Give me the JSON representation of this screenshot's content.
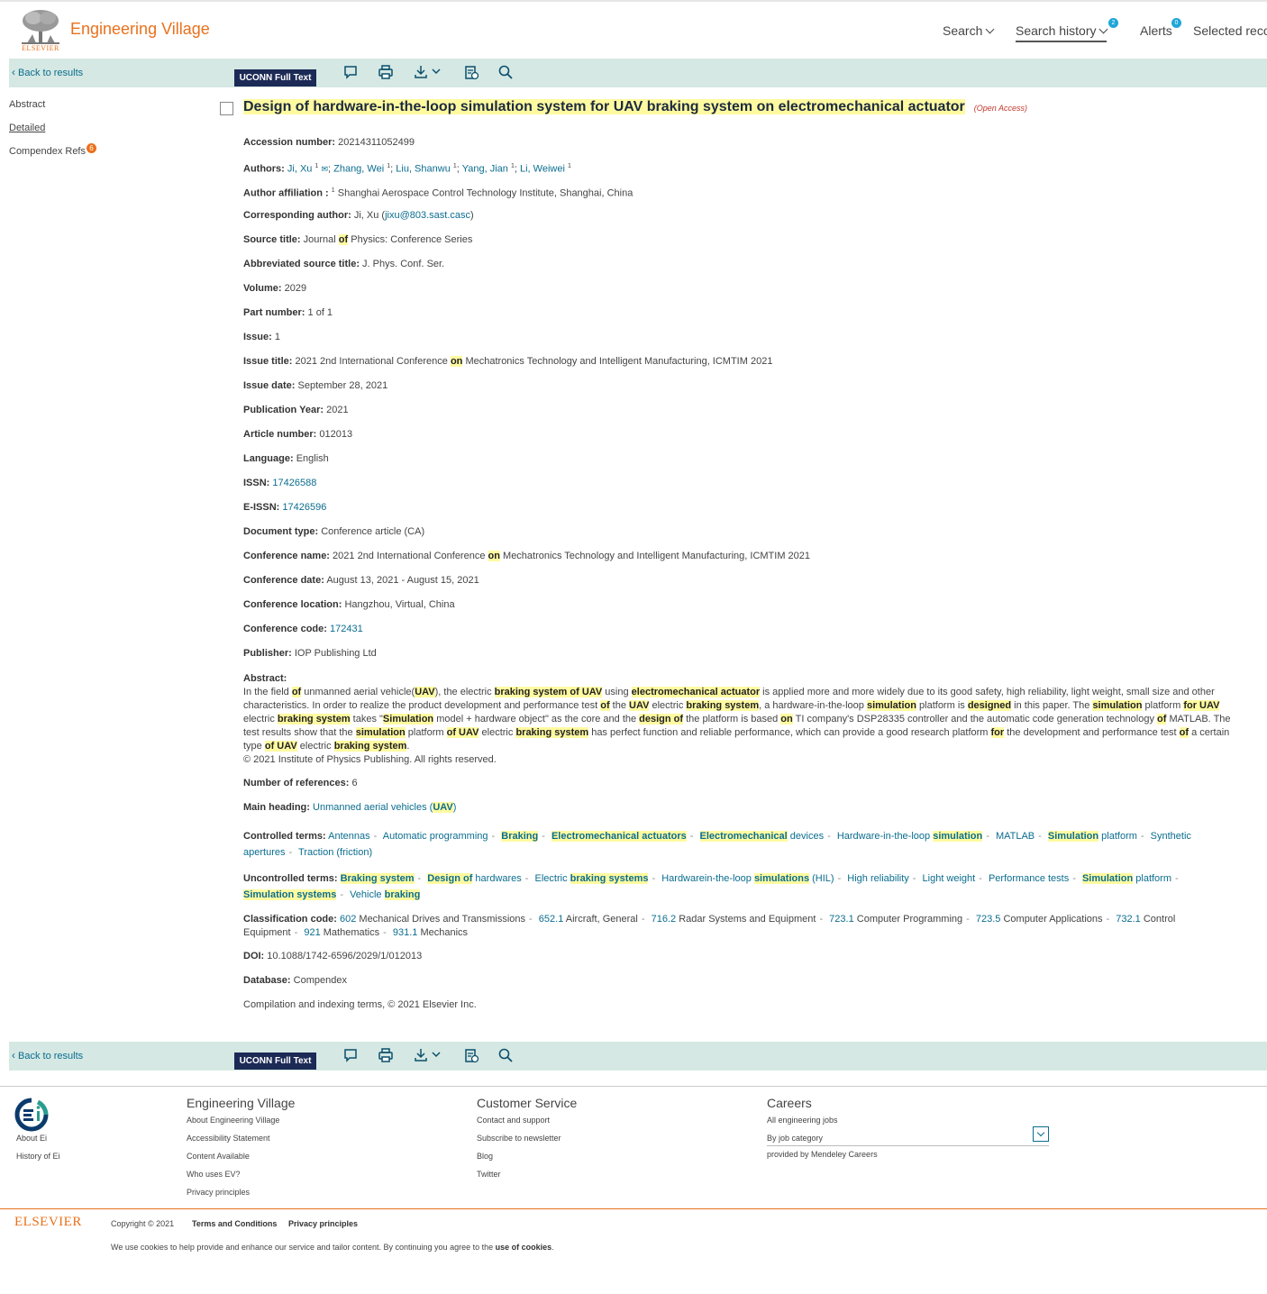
{
  "header": {
    "brand": "Engineering Village",
    "logo_word": "ELSEVIER",
    "nav": {
      "search": "Search",
      "history": "Search history",
      "history_count": "2",
      "alerts": "Alerts",
      "alerts_count": "0",
      "selected": "Selected reco"
    }
  },
  "toolbar": {
    "back": "Back to results",
    "fulltext": "UCONN Full Text"
  },
  "leftnav": {
    "abstract": "Abstract",
    "detailed": "Detailed",
    "refs": "Compendex Refs",
    "refs_count": "6"
  },
  "record": {
    "title": "Design of hardware-in-the-loop simulation system for UAV braking system on electromechanical actuator",
    "open_access": "(Open Access)",
    "accession": {
      "label": "Accession number:",
      "value": "20214311052499"
    },
    "authors_label": "Authors:",
    "authors": [
      "Ji, Xu",
      "Zhang, Wei",
      "Liu, Shanwu",
      "Yang, Jian",
      "Li, Weiwei"
    ],
    "affiliation": {
      "label": "Author affiliation :",
      "sup": "1",
      "value": "Shanghai Aerospace Control Technology Institute, Shanghai, China"
    },
    "corresponding": {
      "label": "Corresponding author:",
      "name": "Ji, Xu (",
      "email": "jixu@803.sast.casc",
      "close": ")"
    },
    "source": {
      "label": "Source title:",
      "pre": "Journal",
      "hl": "of",
      "post": "Physics: Conference Series"
    },
    "abbrev": {
      "label": "Abbreviated source title:",
      "value": "J. Phys. Conf. Ser."
    },
    "volume": {
      "label": "Volume:",
      "value": "2029"
    },
    "part": {
      "label": "Part number:",
      "value": "1 of 1"
    },
    "issue": {
      "label": "Issue:",
      "value": "1"
    },
    "issue_title": {
      "label": "Issue title:",
      "pre": "2021 2nd International Conference",
      "hl": "on",
      "post": "Mechatronics Technology and Intelligent Manufacturing, ICMTIM 2021"
    },
    "issue_date": {
      "label": "Issue date:",
      "value": "September 28, 2021"
    },
    "pub_year": {
      "label": "Publication Year:",
      "value": "2021"
    },
    "article_no": {
      "label": "Article number:",
      "value": "012013"
    },
    "language": {
      "label": "Language:",
      "value": "English"
    },
    "issn": {
      "label": "ISSN:",
      "value": "17426588"
    },
    "eissn": {
      "label": "E-ISSN:",
      "value": "17426596"
    },
    "doctype": {
      "label": "Document type:",
      "value": "Conference article (CA)"
    },
    "conf_name": {
      "label": "Conference name:",
      "pre": "2021 2nd International Conference",
      "hl": "on",
      "post": "Mechatronics Technology and Intelligent Manufacturing, ICMTIM 2021"
    },
    "conf_date": {
      "label": "Conference date:",
      "value": "August 13, 2021 - August 15, 2021"
    },
    "conf_loc": {
      "label": "Conference location:",
      "value": "Hangzhou, Virtual, China"
    },
    "conf_code": {
      "label": "Conference code:",
      "value": "172431"
    },
    "publisher": {
      "label": "Publisher:",
      "value": "IOP Publishing Ltd"
    },
    "abstract_label": "Abstract:",
    "abstract_copyright": "© 2021 Institute of Physics Publishing. All rights reserved.",
    "num_refs": {
      "label": "Number of references:",
      "value": "6"
    },
    "main_heading": {
      "label": "Main heading:",
      "value": "Unmanned aerial vehicles",
      "hl": "UAV"
    },
    "controlled_label": "Controlled terms:",
    "uncontrolled_label": "Uncontrolled terms:",
    "classification_label": "Classification code:",
    "classification": [
      {
        "code": "602",
        "desc": "Mechanical Drives and Transmissions"
      },
      {
        "code": "652.1",
        "desc": "Aircraft, General"
      },
      {
        "code": "716.2",
        "desc": "Radar Systems and Equipment"
      },
      {
        "code": "723.1",
        "desc": "Computer Programming"
      },
      {
        "code": "723.5",
        "desc": "Computer Applications"
      },
      {
        "code": "732.1",
        "desc": "Control Equipment"
      },
      {
        "code": "921",
        "desc": "Mathematics"
      },
      {
        "code": "931.1",
        "desc": "Mechanics"
      }
    ],
    "doi": {
      "label": "DOI:",
      "value": "10.1088/1742-6596/2029/1/012013"
    },
    "database": {
      "label": "Database:",
      "value": "Compendex"
    },
    "compilation": "Compilation and indexing terms, © 2021 Elsevier Inc."
  },
  "footer": {
    "ei_links": [
      "About Ei",
      "History of Ei"
    ],
    "ev_title": "Engineering Village",
    "ev_links": [
      "About Engineering Village",
      "Accessibility Statement",
      "Content Available",
      "Who uses EV?",
      "Privacy principles"
    ],
    "cs_title": "Customer Service",
    "cs_links": [
      "Contact and support",
      "Subscribe to newsletter",
      "Blog",
      "Twitter"
    ],
    "careers_title": "Careers",
    "careers_all": "All engineering jobs",
    "careers_cat": "By job category",
    "careers_provided": "provided by Mendeley Careers",
    "elsevier": "ELSEVIER",
    "copyright": "Copyright © 2021",
    "terms": "Terms and Conditions",
    "privacy": "Privacy principles",
    "cookies_pre": "We use cookies to help provide and enhance our service and tailor content. By continuing you agree to the",
    "cookies_link": "use of cookies",
    "cookies_post": "."
  }
}
